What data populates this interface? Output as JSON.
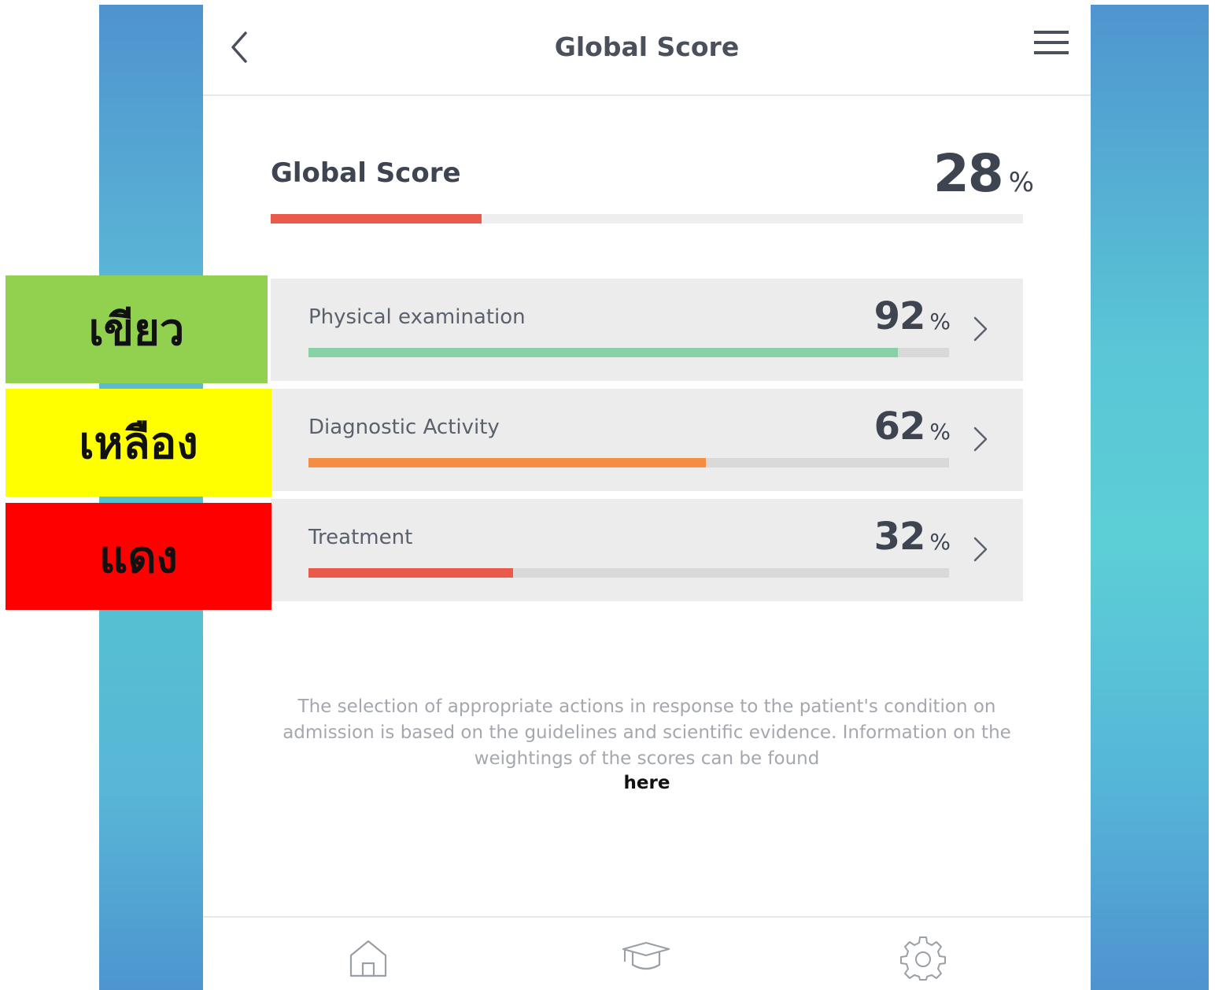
{
  "header": {
    "title": "Global Score",
    "back_icon": "chevron-left-icon",
    "menu_icon": "hamburger-menu-icon"
  },
  "global_score": {
    "label": "Global Score",
    "value": "28",
    "unit": "%",
    "progress": 0.28,
    "bar_color": "#ea5a4a"
  },
  "categories": [
    {
      "label": "Physical examination",
      "value": "92",
      "unit": "%",
      "progress": 0.92,
      "bar_color": "#88d1a7"
    },
    {
      "label": "Diagnostic Activity",
      "value": "62",
      "unit": "%",
      "progress": 0.62,
      "bar_color": "#f48c42"
    },
    {
      "label": "Treatment",
      "value": "32",
      "unit": "%",
      "progress": 0.32,
      "bar_color": "#ea5a4a"
    }
  ],
  "footnote": {
    "text": "The selection of appropriate actions in response to the patient's condition on admission is based on the guidelines and scientific evidence. Information on the weightings of the scores can be found",
    "link": "here"
  },
  "bottom_nav": [
    {
      "icon": "home-icon"
    },
    {
      "icon": "graduation-cap-icon"
    },
    {
      "icon": "gear-icon"
    }
  ],
  "legend": [
    {
      "text": "เขียว",
      "color": "#92d050"
    },
    {
      "text": "เหลือง",
      "color": "#ffff00"
    },
    {
      "text": "แดง",
      "color": "#ff0000"
    }
  ]
}
